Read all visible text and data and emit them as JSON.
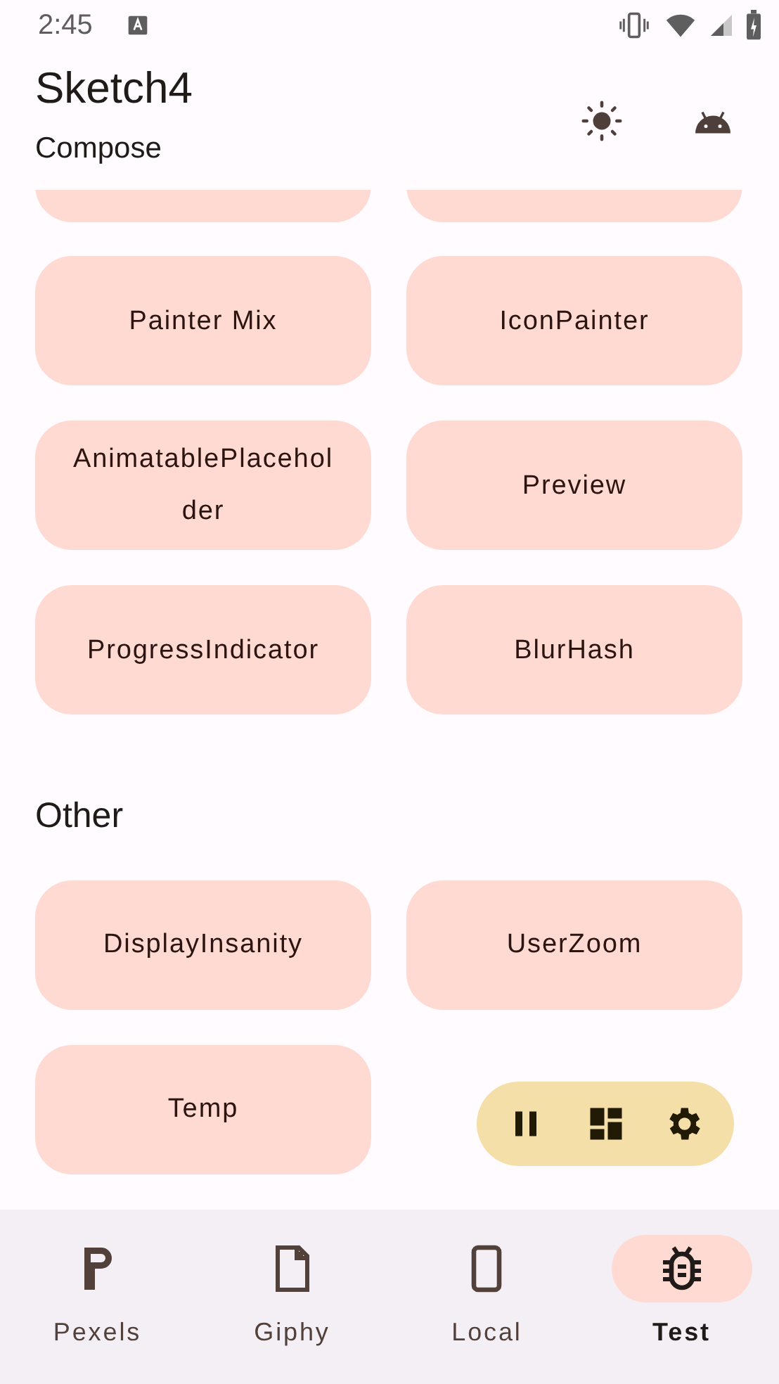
{
  "status_bar": {
    "time": "2:45"
  },
  "app_bar": {
    "title": "Sketch4",
    "subtitle": "Compose"
  },
  "clipped_items": [
    {
      "kind": "button"
    },
    {
      "kind": "button"
    }
  ],
  "sections": [
    {
      "items": [
        {
          "label": "Painter Mix"
        },
        {
          "label": "IconPainter"
        },
        {
          "label": "AnimatablePlaceholder"
        },
        {
          "label": "Preview"
        },
        {
          "label": "ProgressIndicator"
        },
        {
          "label": "BlurHash"
        }
      ]
    },
    {
      "title": "Other",
      "items": [
        {
          "label": "DisplayInsanity"
        },
        {
          "label": "UserZoom"
        },
        {
          "label": "Temp"
        }
      ]
    }
  ],
  "floating_toolbar": {
    "buttons": [
      {
        "kind": "pause"
      },
      {
        "kind": "dashboard"
      },
      {
        "kind": "settings"
      }
    ]
  },
  "bottom_nav": [
    {
      "label": "Pexels",
      "kind": "pexels",
      "selected": false
    },
    {
      "label": "Giphy",
      "kind": "giphy",
      "selected": false
    },
    {
      "label": "Local",
      "kind": "local",
      "selected": false
    },
    {
      "label": "Test",
      "kind": "test",
      "selected": true
    }
  ]
}
